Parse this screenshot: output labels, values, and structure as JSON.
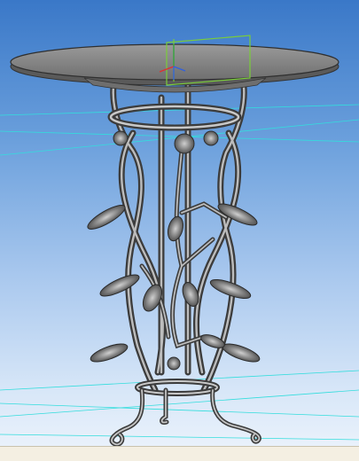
{
  "viewport": {
    "kind": "3d-cad-viewport",
    "model": "wrought-iron-table",
    "background_top": "#3a78c8",
    "background_bottom": "#eef4fc",
    "grid_color": "#33dddd",
    "selection_box_color": "#7acc3a",
    "axis_colors": {
      "x": "#e03030",
      "y": "#3060e0",
      "z": "#30a040"
    }
  },
  "model": {
    "metal_color": "#8a8a8a",
    "metal_highlight": "#d0d0d0",
    "metal_dark": "#3c3c3c",
    "tabletop_color": "#7c7c7c"
  }
}
